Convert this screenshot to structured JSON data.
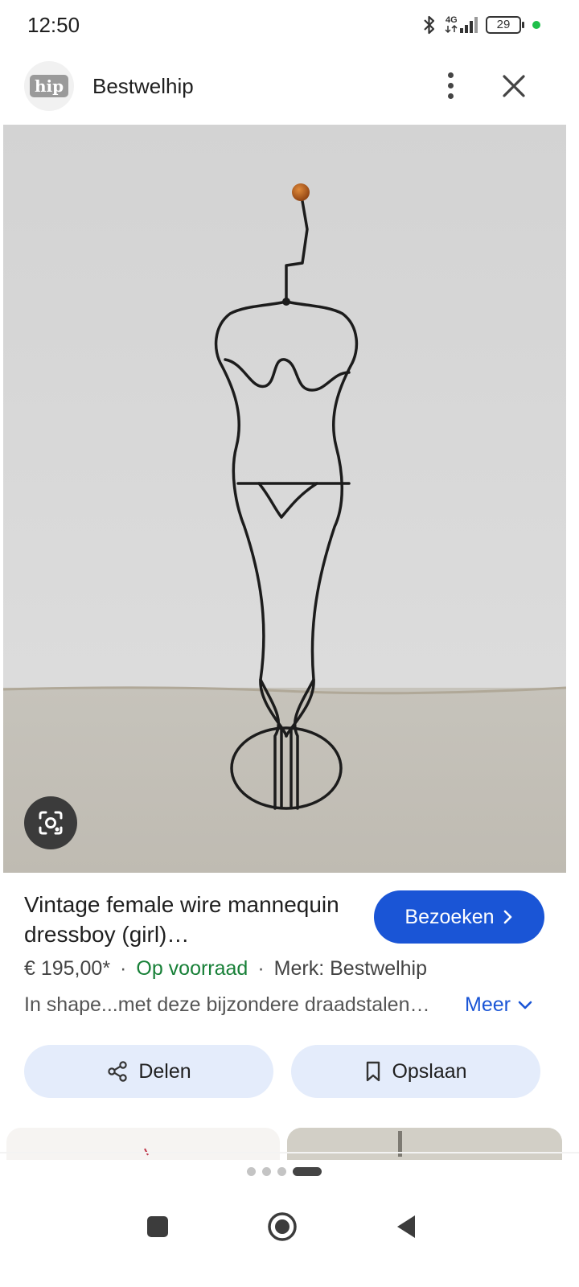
{
  "status_bar": {
    "time": "12:50",
    "network": "4G",
    "battery": "29",
    "icons": [
      "bluetooth-icon",
      "signal-icon",
      "battery-icon",
      "privacy-indicator-dot"
    ]
  },
  "header": {
    "logo_text": "hip",
    "site_name": "Bestwelhip",
    "icons": [
      "more-vert-icon",
      "close-icon"
    ]
  },
  "image": {
    "alt": "Vintage female wire mannequin dressboy",
    "lens_icon": "lens-icon"
  },
  "product": {
    "title": "Vintage female wire mannequin dressboy (girl)…",
    "visit_label": "Bezoeken",
    "price": "€ 195,00*",
    "stock": "Op voorraad",
    "brand": "Merk: Bestwelhip",
    "description": "In shape...met deze bijzondere draadstalen…",
    "more_label": "Meer"
  },
  "actions": {
    "share_label": "Delen",
    "save_label": "Opslaan"
  },
  "pagination": {
    "total": 4,
    "active": 4
  },
  "colors": {
    "accent": "#1a55d6",
    "stock_green": "#188038",
    "pill_bg": "#e4ecfb"
  }
}
